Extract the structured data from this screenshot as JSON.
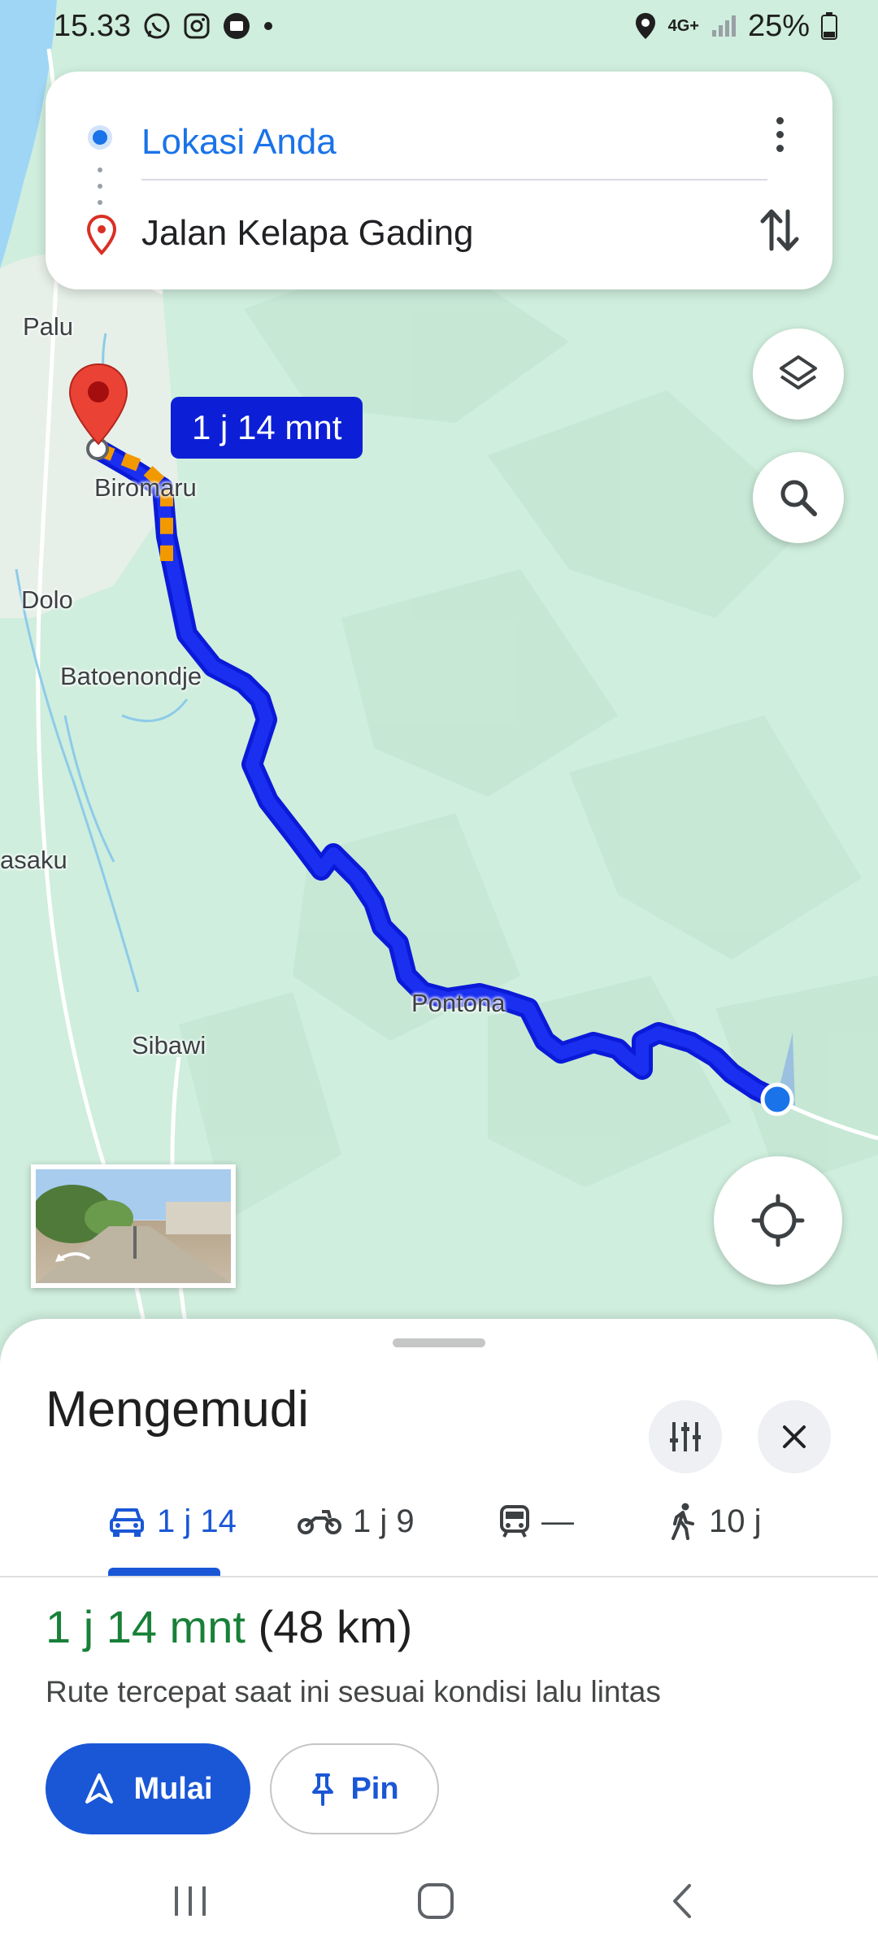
{
  "status_bar": {
    "time": "15.33",
    "network": "4G+",
    "battery": "25%"
  },
  "route_card": {
    "origin": "Lokasi Anda",
    "destination": "Jalan Kelapa Gading"
  },
  "map": {
    "duration_bubble": "1 j 14 mnt",
    "labels": {
      "palu": "Palu",
      "biromaru": "Biromaru",
      "dolo": "Dolo",
      "batoenondje": "Batoenondje",
      "asaku": "asaku",
      "sibawi": "Sibawi",
      "pontona": "Pontona"
    },
    "colors": {
      "route": "#1a2ff0",
      "traffic": "#f29900",
      "map_green": "#cfeedd",
      "water": "#9fd6f5"
    }
  },
  "sheet": {
    "title": "Mengemudi",
    "modes": [
      {
        "label": "1 j 14",
        "icon": "car-icon",
        "active": true
      },
      {
        "label": "1 j 9",
        "icon": "motorcycle-icon",
        "active": false
      },
      {
        "label": "—",
        "icon": "transit-icon",
        "active": false
      },
      {
        "label": "10 j",
        "icon": "walk-icon",
        "active": false
      }
    ],
    "summary_time": "1 j 14 mnt",
    "summary_distance": "(48 km)",
    "summary_desc": "Rute tercepat saat ini sesuai kondisi lalu lintas",
    "start_label": "Mulai",
    "pin_label": "Pin"
  }
}
